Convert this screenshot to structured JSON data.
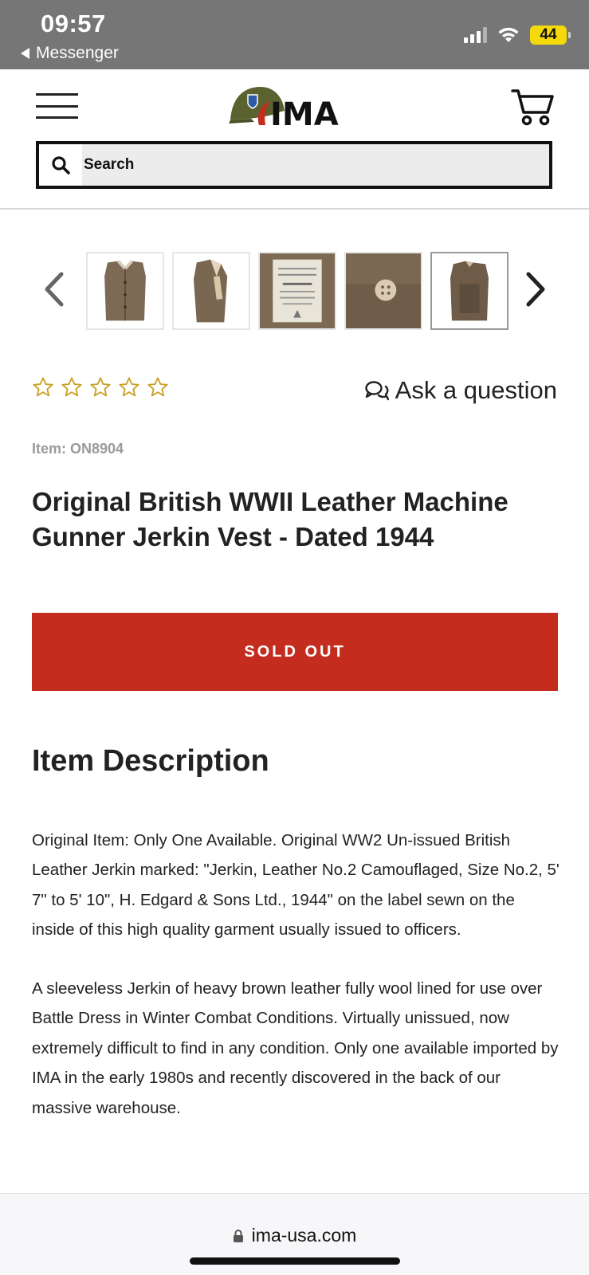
{
  "status_bar": {
    "time": "09:57",
    "back_label": "Messenger",
    "battery_level": "44",
    "signal_bars_active": 3,
    "signal_bars_total": 4
  },
  "header": {
    "menu_icon": "hamburger-menu-icon",
    "logo_text": "IMA",
    "cart_icon": "shopping-cart-icon",
    "search": {
      "placeholder": "Search",
      "value": ""
    }
  },
  "gallery": {
    "prev_icon": "chevron-left-icon",
    "next_icon": "chevron-right-icon",
    "thumbnails": [
      {
        "alt": "Leather jerkin front view"
      },
      {
        "alt": "Leather jerkin side view"
      },
      {
        "alt": "Jerkin label - Size No. 2"
      },
      {
        "alt": "Jerkin button close-up"
      },
      {
        "alt": "Leather jerkin back view"
      }
    ],
    "selected_index": 4
  },
  "rating": {
    "stars_filled": 0,
    "stars_total": 5,
    "ask_label": "Ask a question"
  },
  "product": {
    "item_number": "Item: ON8904",
    "title": "Original British WWII Leather Machine Gunner Jerkin Vest - Dated 1944",
    "sold_out_label": "SOLD OUT"
  },
  "description": {
    "heading": "Item Description",
    "paragraphs": [
      "Original Item: Only One Available. Original WW2 Un-issued British Leather Jerkin marked: \"Jerkin, Leather No.2 Camouflaged, Size No.2, 5' 7\" to 5' 10\", H. Edgard & Sons Ltd., 1944\" on the label sewn on the inside of this high quality garment usually issued to officers.",
      "A sleeveless Jerkin of heavy brown leather fully wool lined for use over Battle Dress in Winter Combat Conditions. Virtually unissued, now extremely difficult to find in any condition. Only one available imported by IMA in the early 1980s and recently discovered in the back of our massive warehouse."
    ]
  },
  "browser": {
    "url": "ima-usa.com"
  },
  "colors": {
    "status_bar_bg": "#767676",
    "sold_out_bg": "#c42d1e",
    "star_outline": "#c9a227",
    "battery": "#f5d90a"
  }
}
